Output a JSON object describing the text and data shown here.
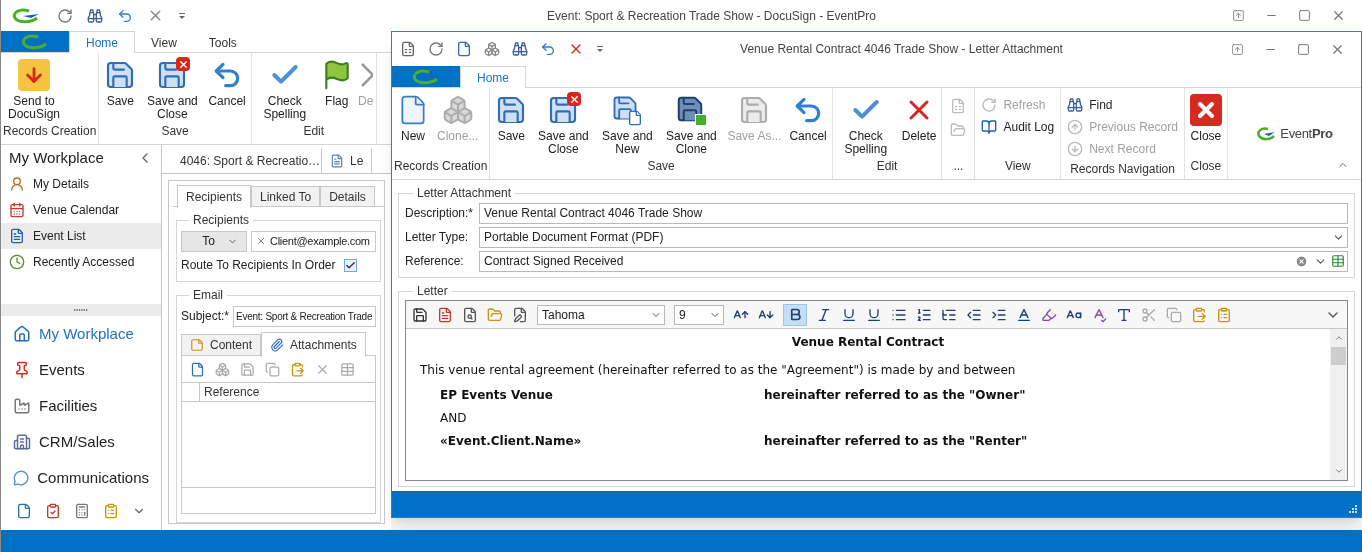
{
  "main_window": {
    "title": "Event: Sport & Recreation Trade Show - DocuSign - EventPro",
    "ribbon_tabs": [
      {
        "label": "Home",
        "selected": true
      },
      {
        "label": "View",
        "selected": false
      },
      {
        "label": "Tools",
        "selected": false
      }
    ],
    "ribbon_groups": [
      {
        "label": "Records Creation",
        "kind": "large",
        "buttons": [
          {
            "label": "Send to DocuSign",
            "kind": "docusign",
            "disabled": false
          }
        ]
      },
      {
        "label": "Save",
        "kind": "large",
        "buttons": [
          {
            "label": "Save",
            "kind": "save",
            "disabled": false
          },
          {
            "label": "Save and Close",
            "kind": "save_close",
            "disabled": false
          },
          {
            "label": "Cancel",
            "kind": "cancel",
            "disabled": false
          }
        ]
      },
      {
        "label": "Edit",
        "kind": "large",
        "buttons": [
          {
            "label": "Check Spelling",
            "kind": "spelling",
            "disabled": false
          },
          {
            "label": "Flag",
            "kind": "flag",
            "disabled": false
          },
          {
            "label": "De",
            "kind": "cut_delete",
            "disabled": true
          }
        ]
      }
    ],
    "sidebar": {
      "title": "My Workplace",
      "items": [
        {
          "label": "My Details",
          "kind": "details",
          "selected": false
        },
        {
          "label": "Venue Calendar",
          "kind": "calendar",
          "selected": false
        },
        {
          "label": "Event List",
          "kind": "list",
          "selected": true
        },
        {
          "label": "Recently Accessed",
          "kind": "recent",
          "selected": false
        }
      ],
      "nav": [
        {
          "label": "My Workplace",
          "kind": "workplace",
          "selected": true
        },
        {
          "label": "Events",
          "kind": "events",
          "selected": false
        },
        {
          "label": "Facilities",
          "kind": "facilities",
          "selected": false
        },
        {
          "label": "CRM/Sales",
          "kind": "crm",
          "selected": false
        },
        {
          "label": "Communications",
          "kind": "communications",
          "selected": false
        }
      ]
    },
    "document_tabs": [
      {
        "label": "4046: Sport & Recreatio…",
        "kind": "event"
      },
      {
        "label": "Le",
        "kind": "letter"
      }
    ],
    "record": {
      "tabs": [
        {
          "label": "Recipients",
          "selected": true
        },
        {
          "label": "Linked To",
          "selected": false
        },
        {
          "label": "Details",
          "selected": false
        }
      ],
      "recipients": {
        "legend": "Recipients",
        "type": "To",
        "address": "Client@example.com",
        "route_label": "Route To Recipients In Order",
        "route_checked": true
      },
      "email": {
        "legend": "Email",
        "subject_label": "Subject:*",
        "subject": "Event: Sport & Recreation Trade",
        "tabs": [
          {
            "label": "Content",
            "kind": "content",
            "selected": false
          },
          {
            "label": "Attachments",
            "kind": "attachments",
            "selected": true
          }
        ],
        "columns": [
          "Reference"
        ]
      }
    }
  },
  "dialog": {
    "title": "Venue Rental Contract 4046 Trade Show - Letter Attachment",
    "ribbon_tabs": [
      {
        "label": "Home",
        "selected": true
      }
    ],
    "ribbon_groups": [
      {
        "label": "Records Creation",
        "kind": "large",
        "buttons": [
          {
            "label": "New",
            "kind": "new",
            "disabled": false
          },
          {
            "label": "Clone...",
            "kind": "clone",
            "disabled": true
          }
        ]
      },
      {
        "label": "Save",
        "kind": "large",
        "buttons": [
          {
            "label": "Save",
            "kind": "save",
            "disabled": false
          },
          {
            "label": "Save and Close",
            "kind": "save_close",
            "disabled": false
          },
          {
            "label": "Save and New",
            "kind": "save_new",
            "disabled": false
          },
          {
            "label": "Save and Clone",
            "kind": "save_clone",
            "disabled": false
          },
          {
            "label": "Save As...",
            "kind": "save_as",
            "disabled": true
          },
          {
            "label": "Cancel",
            "kind": "cancel",
            "disabled": false
          }
        ]
      },
      {
        "label": "Edit",
        "kind": "large",
        "buttons": [
          {
            "label": "Check Spelling",
            "kind": "spelling",
            "disabled": false
          },
          {
            "label": "Delete",
            "kind": "delete",
            "disabled": false
          }
        ]
      },
      {
        "label": "...",
        "kind": "small",
        "buttons": [
          {
            "kind": "sheet",
            "disabled": true
          },
          {
            "kind": "folder",
            "disabled": true
          }
        ]
      },
      {
        "label": "View",
        "kind": "small",
        "buttons": [
          {
            "label": "Refresh",
            "kind": "refresh",
            "disabled": true
          },
          {
            "label": "Audit Log",
            "kind": "audit",
            "disabled": false
          }
        ]
      },
      {
        "label": "Records Navigation",
        "kind": "small",
        "buttons": [
          {
            "label": "Find",
            "kind": "find",
            "disabled": false
          },
          {
            "label": "Previous Record",
            "kind": "previous",
            "disabled": true
          },
          {
            "label": "Next Record",
            "kind": "next",
            "disabled": true
          }
        ]
      },
      {
        "label": "Close",
        "kind": "large",
        "buttons": [
          {
            "label": "Close",
            "kind": "close",
            "disabled": false
          }
        ]
      }
    ],
    "brand": "Event**Pro**",
    "attachment": {
      "legend": "Letter Attachment",
      "fields": [
        {
          "label": "Description:*",
          "value": "Venue Rental Contract 4046 Trade Show",
          "kind": "text"
        },
        {
          "label": "Letter Type:",
          "value": "Portable Document Format (PDF)",
          "kind": "dropdown"
        },
        {
          "label": "Reference:",
          "value": "Contract Signed Received",
          "kind": "lookup"
        }
      ]
    },
    "letter": {
      "legend": "Letter",
      "font": "Tahoma",
      "size": "9",
      "bold_selected": true,
      "heading": "Venue Rental Contract",
      "intro": "This venue rental agreement (hereinafter referred to as the \"Agreement\") is made by and between",
      "rows": [
        {
          "kind": "party",
          "name": "EP Events Venue",
          "role": "hereinafter referred to as the \"Owner\""
        },
        {
          "kind": "conjunction",
          "text": "AND"
        },
        {
          "kind": "party",
          "name": "«Event.Client.Name»",
          "role": "hereinafter referred to as the \"Renter\""
        }
      ]
    }
  }
}
